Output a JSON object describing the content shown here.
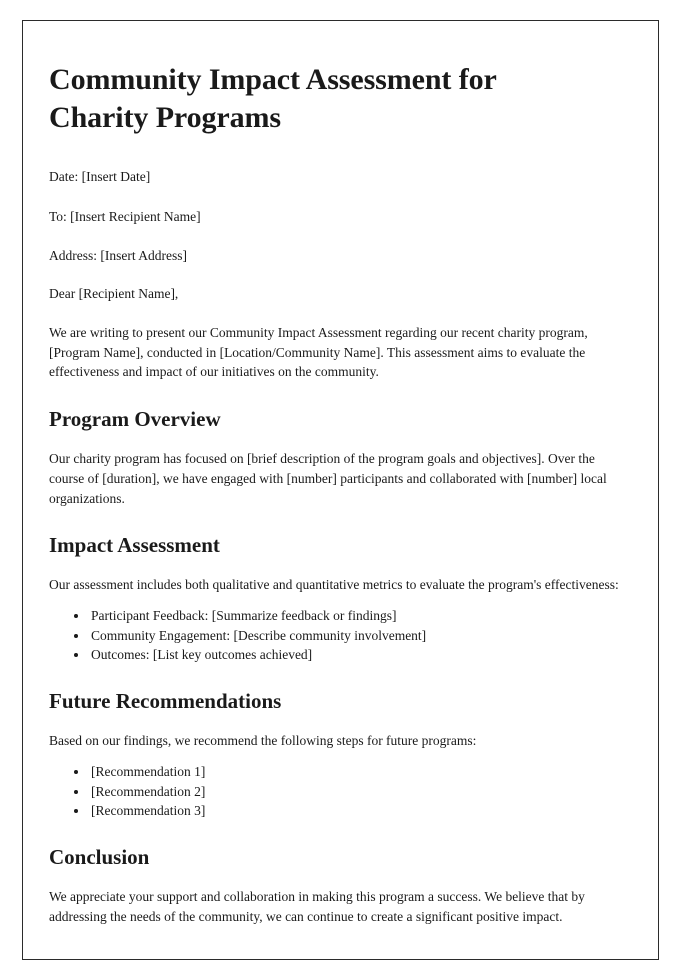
{
  "document": {
    "title": "Community Impact Assessment for Charity Programs",
    "header_fields": [
      {
        "label": "Date:",
        "value": "[Insert Date]",
        "text": "Date: [Insert Date]"
      },
      {
        "label": "To:",
        "value": "[Insert Recipient Name]",
        "text": "To: [Insert Recipient Name]"
      },
      {
        "label": "Address:",
        "value": "[Insert Address]",
        "text": "Address: [Insert Address]"
      }
    ],
    "salutation": "Dear [Recipient Name],",
    "intro_paragraph": "We are writing to present our Community Impact Assessment regarding our recent charity program, [Program Name], conducted in [Location/Community Name]. This assessment aims to evaluate the effectiveness and impact of our initiatives on the community.",
    "sections": [
      {
        "heading": "Program Overview",
        "paragraph": "Our charity program has focused on [brief description of the program goals and objectives]. Over the course of [duration], we have engaged with [number] participants and collaborated with [number] local organizations."
      },
      {
        "heading": "Impact Assessment",
        "paragraph": "Our assessment includes both qualitative and quantitative metrics to evaluate the program's effectiveness:",
        "bullets": [
          "Participant Feedback: [Summarize feedback or findings]",
          "Community Engagement: [Describe community involvement]",
          "Outcomes: [List key outcomes achieved]"
        ]
      },
      {
        "heading": "Future Recommendations",
        "paragraph": "Based on our findings, we recommend the following steps for future programs:",
        "bullets": [
          "[Recommendation 1]",
          "[Recommendation 2]",
          "[Recommendation 3]"
        ]
      },
      {
        "heading": "Conclusion",
        "paragraph": "We appreciate your support and collaboration in making this program a success. We believe that by addressing the needs of the community, we can continue to create a significant positive impact."
      }
    ]
  },
  "style": {
    "page_background": "#ffffff",
    "page_border_color": "#2b2b2b",
    "text_color": "#1a1a1a"
  }
}
